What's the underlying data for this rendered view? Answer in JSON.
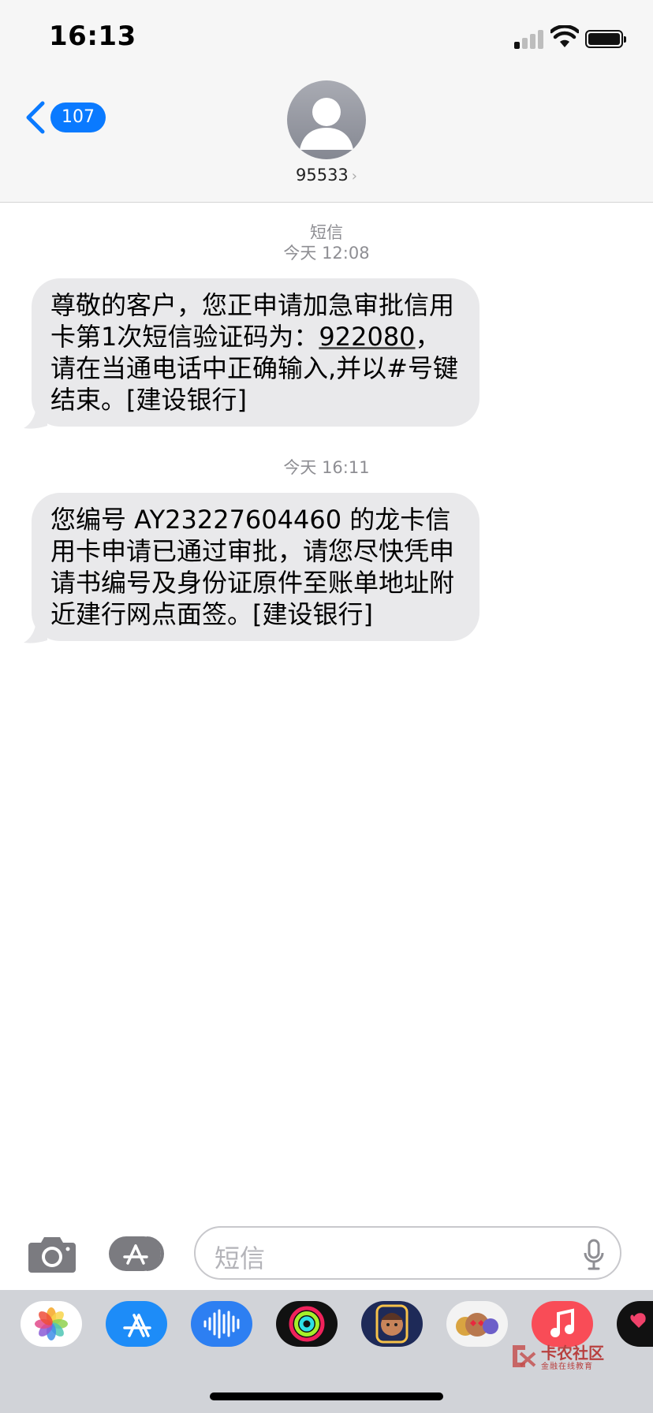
{
  "status_bar": {
    "time": "16:13"
  },
  "nav": {
    "back_count": "107",
    "contact": "95533",
    "contact_chevron": "›"
  },
  "thread": {
    "service_label": "短信",
    "ts1": "今天 12:08",
    "msg1_pre": "尊敬的客户，您正申请加急审批信用卡第1次短信验证码为：",
    "msg1_code": "922080",
    "msg1_post": "，请在当通电话中正确输入,并以#号键结束。[建设银行]",
    "ts2": "今天 16:11",
    "msg2": "您编号 AY23227604460 的龙卡信用卡申请已通过审批，请您尽快凭申请书编号及身份证原件至账单地址附近建行网点面签。[建设银行]"
  },
  "compose": {
    "placeholder": "短信"
  },
  "drawer": {
    "apps": [
      "photos-app",
      "app-store-app",
      "audio-messages-app",
      "fitness-app",
      "memoji-app",
      "animoji-app",
      "music-app",
      "digital-touch-app"
    ]
  },
  "watermark": {
    "title": "卡农社区",
    "subtitle": "金融在线教育"
  },
  "colors": {
    "accent": "#0a7aff",
    "bubble": "#e9e9eb",
    "music": "#f94c57"
  }
}
